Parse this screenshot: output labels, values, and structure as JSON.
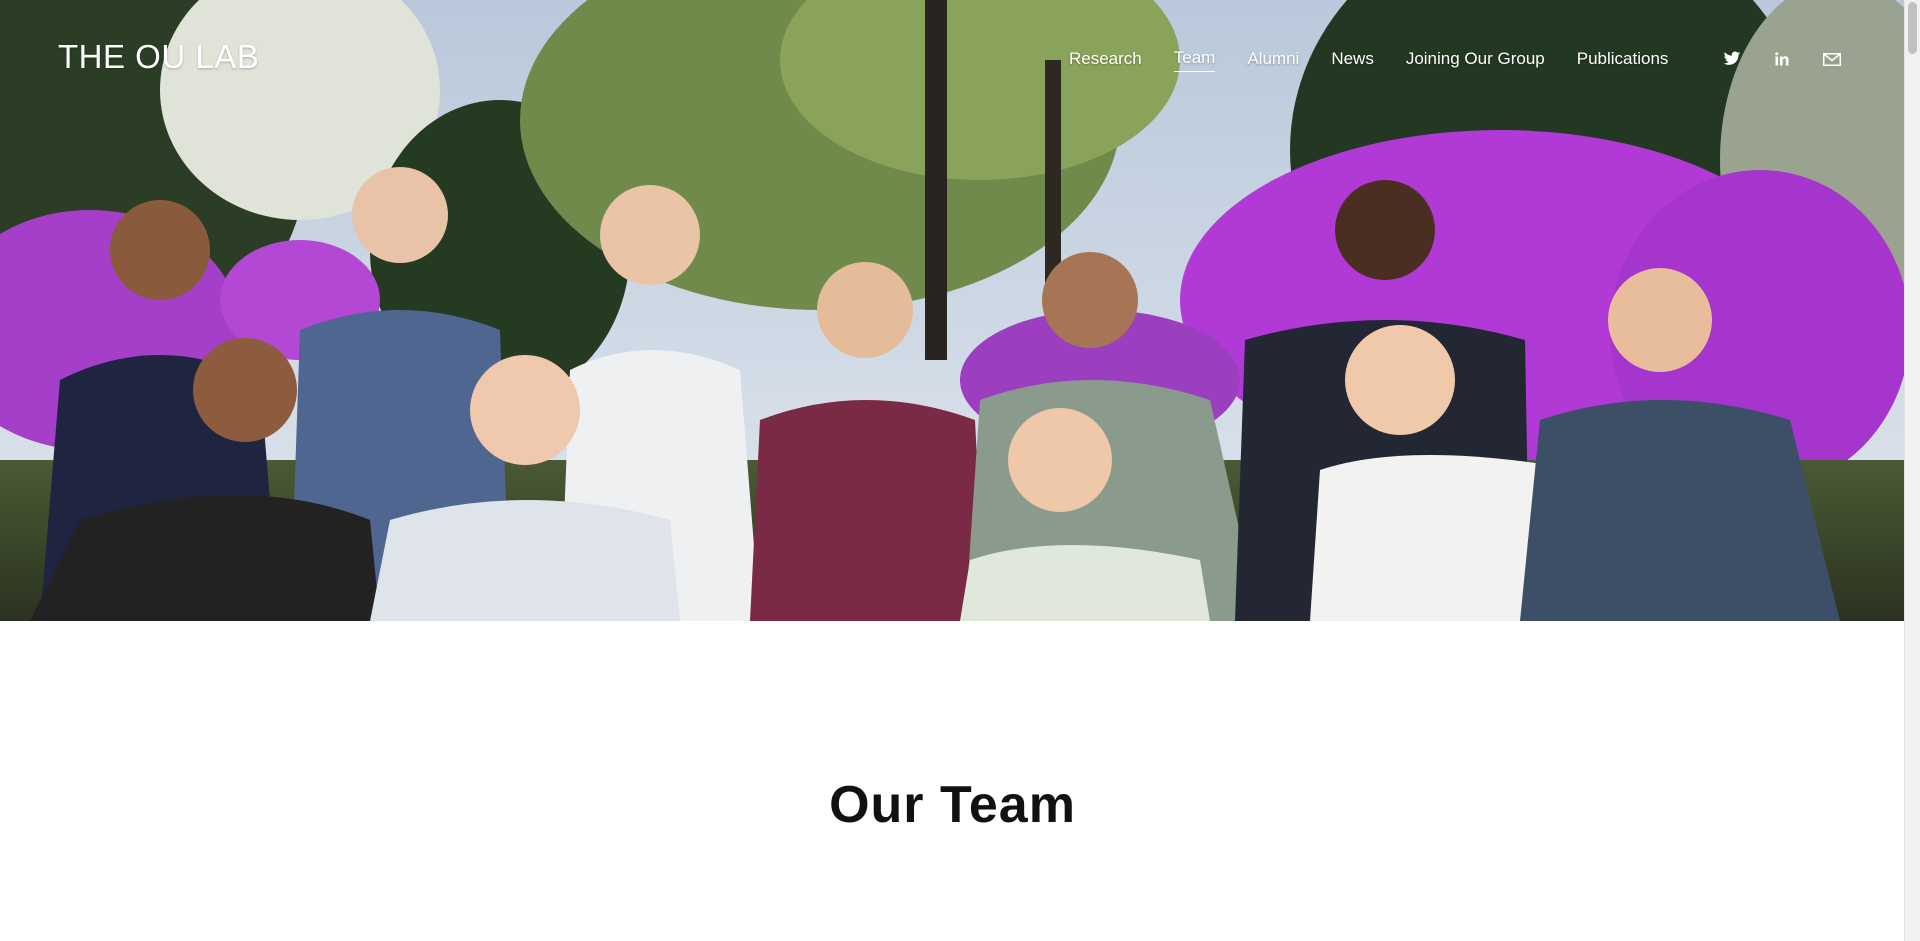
{
  "site": {
    "logo": "THE OU LAB"
  },
  "nav": {
    "items": [
      {
        "label": "Research",
        "active": false
      },
      {
        "label": "Team",
        "active": true
      },
      {
        "label": "Alumni",
        "active": false
      },
      {
        "label": "News",
        "active": false
      },
      {
        "label": "Joining Our Group",
        "active": false
      },
      {
        "label": "Publications",
        "active": false
      }
    ]
  },
  "social": {
    "icons": [
      "twitter-icon",
      "linkedin-icon",
      "email-icon"
    ]
  },
  "hero": {
    "image": "group-photo",
    "colors": {
      "sky": "#cfd9e6",
      "foliage": "#31472a",
      "blossom": "#b13ad6"
    }
  },
  "main": {
    "section_title": "Our Team"
  }
}
